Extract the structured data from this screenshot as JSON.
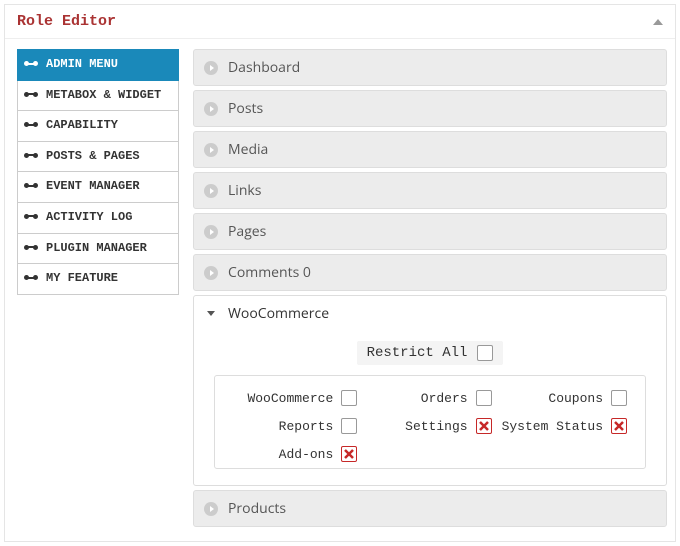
{
  "header": {
    "title": "Role Editor"
  },
  "sidebar": {
    "items": [
      {
        "label": "ADMIN MENU",
        "active": true
      },
      {
        "label": "METABOX & WIDGET"
      },
      {
        "label": "CAPABILITY"
      },
      {
        "label": "POSTS & PAGES"
      },
      {
        "label": "EVENT MANAGER"
      },
      {
        "label": "ACTIVITY LOG"
      },
      {
        "label": "PLUGIN MANAGER"
      },
      {
        "label": "MY FEATURE"
      }
    ]
  },
  "accordion": {
    "sections": [
      {
        "label": "Dashboard"
      },
      {
        "label": "Posts"
      },
      {
        "label": "Media"
      },
      {
        "label": "Links"
      },
      {
        "label": "Pages"
      },
      {
        "label": "Comments 0"
      },
      {
        "label": "WooCommerce",
        "open": true
      },
      {
        "label": "Products"
      }
    ]
  },
  "woo": {
    "restrict_label": "Restrict All",
    "restrict_checked": false,
    "options": [
      {
        "label": "WooCommerce",
        "checked": false
      },
      {
        "label": "Orders",
        "checked": false
      },
      {
        "label": "Coupons",
        "checked": false
      },
      {
        "label": "Reports",
        "checked": false
      },
      {
        "label": "Settings",
        "checked": true
      },
      {
        "label": "System Status",
        "checked": true
      },
      {
        "label": "Add-ons",
        "checked": true
      }
    ]
  }
}
